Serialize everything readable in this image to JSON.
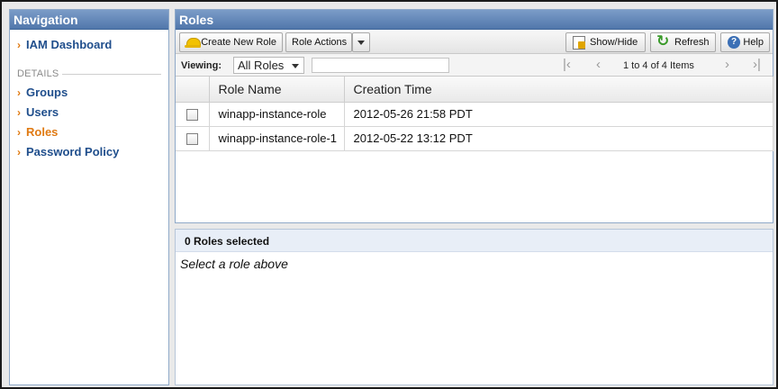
{
  "nav": {
    "title": "Navigation",
    "dashboard": "IAM Dashboard",
    "section_label": "DETAILS",
    "items": [
      {
        "label": "Groups"
      },
      {
        "label": "Users"
      },
      {
        "label": "Roles"
      },
      {
        "label": "Password Policy"
      }
    ],
    "chevron": "›"
  },
  "roles": {
    "title": "Roles",
    "toolbar": {
      "create": "Create New Role",
      "actions": "Role Actions",
      "showhide": "Show/Hide",
      "refresh": "Refresh",
      "help": "Help"
    },
    "viewing": {
      "label": "Viewing:",
      "selected": "All Roles",
      "filter_value": ""
    },
    "pager": {
      "text": "1 to 4 of 4 Items",
      "first": "|‹",
      "prev": "‹",
      "next": "›",
      "last": "›|"
    },
    "columns": [
      "Role Name",
      "Creation Time"
    ],
    "rows": [
      {
        "name": "winapp-instance-role",
        "created": "2012-05-26 21:58 PDT"
      },
      {
        "name": "winapp-instance-role-1",
        "created": "2012-05-22 13:12 PDT"
      }
    ]
  },
  "detail": {
    "header": "0 Roles selected",
    "message": "Select a role above"
  },
  "icons": {
    "create": "role-hat-icon",
    "showhide": "columns-icon",
    "refresh": "refresh-icon",
    "help": "help-icon"
  },
  "colors": {
    "header_blue": "#5177ab",
    "link_blue": "#1f4e8c",
    "active_orange": "#e07a12"
  }
}
